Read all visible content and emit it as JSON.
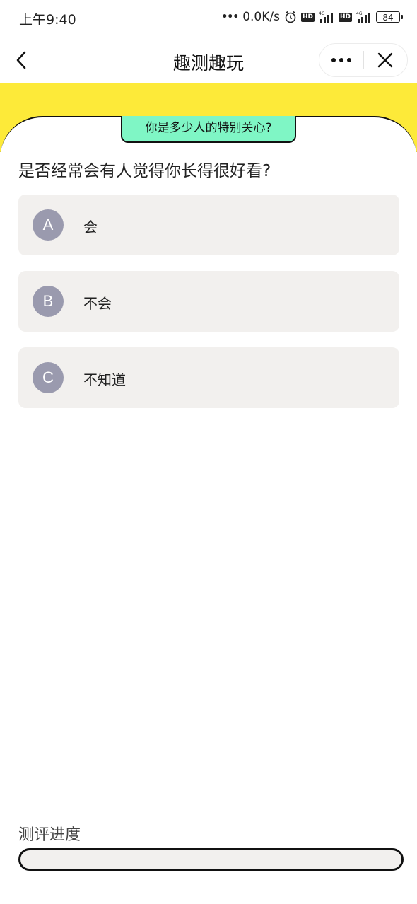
{
  "status_bar": {
    "time": "上午9:40",
    "network_speed": "0.0K/s",
    "hd_label": "HD",
    "network_type": "4G",
    "battery": "84"
  },
  "nav": {
    "title": "趣测趣玩",
    "icons": {
      "back": "chevron-left-icon",
      "more": "more-dots-icon",
      "close": "close-icon"
    }
  },
  "quiz": {
    "topic": "你是多少人的特别关心?",
    "question": "是否经常会有人觉得你长得很好看?",
    "options": [
      {
        "letter": "A",
        "text": "会"
      },
      {
        "letter": "B",
        "text": "不会"
      },
      {
        "letter": "C",
        "text": "不知道"
      }
    ]
  },
  "progress": {
    "label": "测评进度",
    "value": 0
  },
  "colors": {
    "banner": "#fdea39",
    "tag": "#7ff6c5",
    "option_bg": "#f2f0ee",
    "letter_badge": "#9a9aae"
  }
}
